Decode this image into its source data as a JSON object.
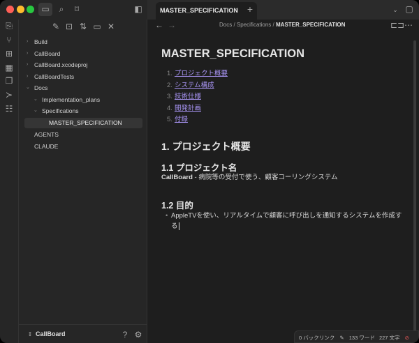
{
  "tabs": [
    {
      "label": "MASTER_SPECIFICATION",
      "close": "×"
    }
  ],
  "new_tab": "+",
  "breadcrumb": {
    "parts": [
      "Docs",
      "Specifications"
    ],
    "current": "MASTER_SPECIFICATION",
    "sep": "/"
  },
  "file_tree": [
    {
      "label": "Build",
      "type": "folder",
      "expanded": false,
      "depth": 0
    },
    {
      "label": "CallBoard",
      "type": "folder",
      "expanded": false,
      "depth": 0
    },
    {
      "label": "CallBoard.xcodeproj",
      "type": "folder",
      "expanded": false,
      "depth": 0
    },
    {
      "label": "CallBoardTests",
      "type": "folder",
      "expanded": false,
      "depth": 0
    },
    {
      "label": "Docs",
      "type": "folder",
      "expanded": true,
      "depth": 0
    },
    {
      "label": "Implementation_plans",
      "type": "folder",
      "expanded": true,
      "depth": 1
    },
    {
      "label": "Specifications",
      "type": "folder",
      "expanded": true,
      "depth": 1
    },
    {
      "label": "MASTER_SPECIFICATION",
      "type": "file",
      "depth": 2,
      "active": true
    },
    {
      "label": "AGENTS",
      "type": "file",
      "depth": 0
    },
    {
      "label": "CLAUDE",
      "type": "file",
      "depth": 0
    }
  ],
  "vault": {
    "name": "CallBoard"
  },
  "doc": {
    "title": "MASTER_SPECIFICATION",
    "toc": [
      {
        "n": "1.",
        "t": "プロジェクト概要"
      },
      {
        "n": "2.",
        "t": "システム構成"
      },
      {
        "n": "3.",
        "t": "技術仕様"
      },
      {
        "n": "4.",
        "t": "開発計画"
      },
      {
        "n": "5.",
        "t": "付録"
      }
    ],
    "h2": "1. プロジェクト概要",
    "h3a": "1.1 プロジェクト名",
    "p_bold": "CallBoard",
    "p_rest": " - 病院等の受付で使う、顧客コーリングシステム",
    "h3b": "1.2 目的",
    "bullet": "AppleTVを使い、リアルタイムで顧客に呼び出しを通知するシステムを作成する"
  },
  "status": {
    "backlinks": "0 バックリンク",
    "words": "133 ワード",
    "chars": "227 文字"
  },
  "colors": {
    "link": "#a995f5",
    "bg": "#1e1e1e",
    "sidebar": "#262626"
  }
}
